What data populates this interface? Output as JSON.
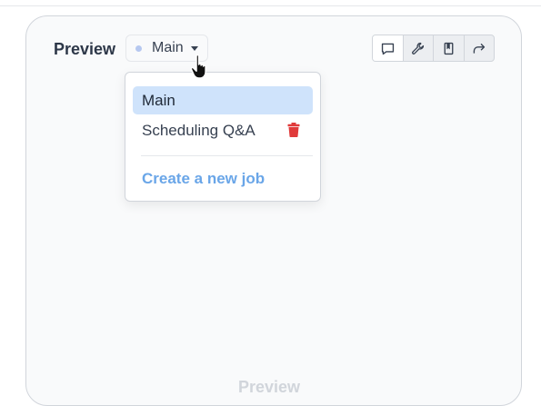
{
  "panel": {
    "title": "Preview",
    "footer_text": "Preview"
  },
  "job_selector": {
    "selected": "Main"
  },
  "toolbar": {
    "buttons": [
      {
        "icon": "comment-icon"
      },
      {
        "icon": "wrench-icon"
      },
      {
        "icon": "book-icon"
      },
      {
        "icon": "share-icon"
      }
    ]
  },
  "menu": {
    "items": [
      {
        "label": "Main",
        "selected": true
      },
      {
        "label": "Scheduling Q&A",
        "deletable": true
      }
    ],
    "create_label": "Create a new job"
  },
  "colors": {
    "accent": "#6aa6e8",
    "selected_bg": "#cfe3fb",
    "danger": "#e03b3b"
  }
}
